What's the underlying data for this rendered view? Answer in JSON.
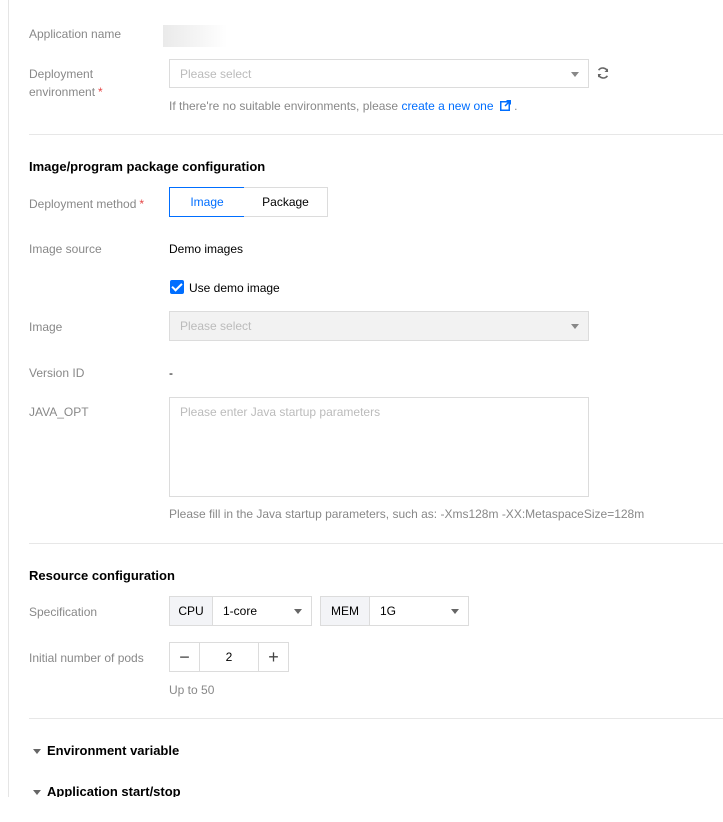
{
  "app_name": {
    "label": "Application name",
    "value": ""
  },
  "deploy_env": {
    "label_line1": "Deployment",
    "label_line2": "environment",
    "required_mark": "*",
    "placeholder": "Please select",
    "hint_prefix": "If there're no suitable environments, please ",
    "hint_link": "create a new one",
    "hint_suffix": " ."
  },
  "image_section": {
    "title": "Image/program package configuration",
    "method_label": "Deployment method",
    "method_required": "*",
    "method_options": [
      "Image",
      "Package"
    ],
    "method_selected": "Image",
    "source_label": "Image source",
    "source_value": "Demo images",
    "use_demo_label": "Use demo image",
    "use_demo_checked": true,
    "image_label": "Image",
    "image_placeholder": "Please select",
    "version_label": "Version ID",
    "version_value": "-",
    "java_label": "JAVA_OPT",
    "java_placeholder": "Please enter Java startup parameters",
    "java_hint": "Please fill in the Java startup parameters, such as: -Xms128m -XX:MetaspaceSize=128m"
  },
  "resource_section": {
    "title": "Resource configuration",
    "spec_label": "Specification",
    "cpu_label": "CPU",
    "cpu_value": "1-core",
    "mem_label": "MEM",
    "mem_value": "1G",
    "pods_label": "Initial number of pods",
    "pods_minus": "−",
    "pods_value": "2",
    "pods_plus": "+",
    "pods_hint": "Up to 50"
  },
  "collapsibles": {
    "env_var": "Environment variable",
    "start_stop": "Application start/stop"
  },
  "colors": {
    "accent": "#006eff",
    "required": "#e54545",
    "label": "#888888"
  }
}
